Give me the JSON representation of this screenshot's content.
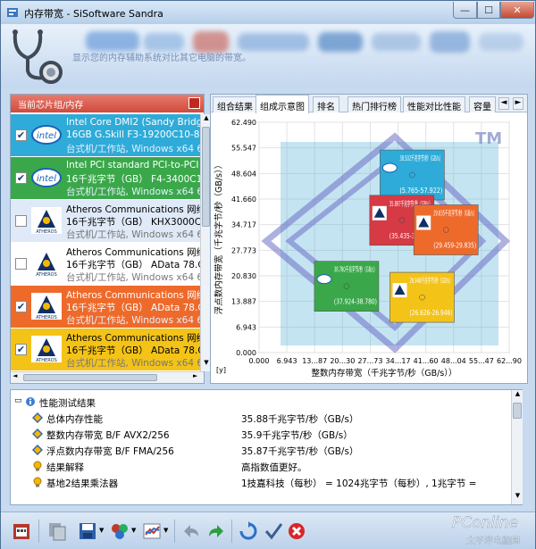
{
  "window": {
    "title": "内存带宽 - SiSoftware Sandra",
    "minimize": "—",
    "maximize": "☐",
    "close": "✕"
  },
  "header": {
    "description": "显示您的内存辅助系统对比其它电脑的带宽。"
  },
  "left_panel": {
    "title": "当前芯片组/内存",
    "items": [
      {
        "checked": true,
        "logo": "intel-logo",
        "line1": "Intel Core DMI2 (Sandy Bridge",
        "line2": "16GB G.Skill F3-19200C10-8GE",
        "line3": "台式机/工作站, Windows x64 6.1",
        "bg": "#2eabd8"
      },
      {
        "checked": true,
        "logo": "intel-logo",
        "line1": "Intel PCI standard PCI-to-PCI b",
        "line2": "16千兆字节（GB） F4-3400C16-",
        "line3": "台式机/工作站, Windows x64 6.1",
        "bg": "#3aa84a"
      },
      {
        "checked": false,
        "logo": "atheros-logo",
        "line1": "Atheros Communications 网络",
        "line2": "16千兆字节（GB） KHX3000C1",
        "line3": "台式机/工作站, Windows x64 6.",
        "bg": "#dfe9f7"
      },
      {
        "checked": false,
        "logo": "atheros-logo",
        "line1": "Atheros Communications 网络",
        "line2": "16千兆字节（GB） AData 78.CA",
        "line3": "台式机/工作站, Windows x64 6.",
        "bg": "#ffffff"
      },
      {
        "checked": true,
        "logo": "atheros-logo",
        "line1": "Atheros Communications 网络",
        "line2": "16千兆字节（GB） AData 78.CA",
        "line3": "台式机/工作站, Windows x64 6.",
        "bg": "#ee6a2b"
      },
      {
        "checked": true,
        "logo": "atheros-logo",
        "line1": "Atheros Communications 网络",
        "line2": "16千兆字节（GB） AData 78.CA",
        "line3": "台式机/工作站, Windows x64 6.",
        "bg": "#f4c318"
      }
    ]
  },
  "tabs": {
    "items": [
      "组合结果",
      "组成示意图",
      "排名",
      "热门排行榜",
      "性能对比性能",
      "容量"
    ],
    "active": 1,
    "prev": "◄",
    "next": "►"
  },
  "chart_data": {
    "type": "scatter",
    "xlabel": "整数内存带宽（千兆字节/秒（GB/s））",
    "ylabel": "浮点数内存带宽（千兆字节/秒（GB/s））",
    "xlim": [
      0,
      62.9
    ],
    "ylim": [
      0,
      62.49
    ],
    "x_ticks": [
      "0.000",
      "6.943",
      "13...87",
      "20...30",
      "27...73",
      "34...17",
      "41...60",
      "48...04",
      "55...47",
      "62...90"
    ],
    "y_ticks": [
      "0.000",
      "6.943",
      "13.887",
      "20.830",
      "27.773",
      "34.717",
      "41.660",
      "48.604",
      "55.547",
      "62.490"
    ],
    "y_unit": "[y]",
    "watermark": "TM",
    "boxes": [
      {
        "value": "38.502千兆字节/秒（GB/s）",
        "range": "(5.765-57.922)",
        "color": "#2eabd8",
        "logo": "intel",
        "x": 38.5,
        "y": 48.2
      },
      {
        "value": "35.897千兆字节/秒（GB/s）",
        "range": "(35.435-35.897)",
        "color": "#d53a45",
        "logo": "atheros",
        "x": 35.9,
        "y": 35.9
      },
      {
        "value": "29.835千兆字节/秒（GB/s）",
        "range": "(29.459-29.835)",
        "color": "#ee6a2b",
        "logo": "atheros",
        "x": 47.0,
        "y": 33.3
      },
      {
        "value": "38.780千兆字节/秒（GB/s）",
        "range": "(37.924-38.780)",
        "color": "#3aa84a",
        "logo": "intel",
        "x": 22.0,
        "y": 18.0
      },
      {
        "value": "26.946千兆字节/秒（GB/s）",
        "range": "(26.626-26.946)",
        "color": "#f4c318",
        "logo": "atheros",
        "x": 41.0,
        "y": 15.0
      }
    ]
  },
  "results": {
    "header": "性能测试结果",
    "rows": [
      {
        "icon": "diamond-icon",
        "name": "总体内存性能",
        "value": "35.88千兆字节/秒（GB/s）"
      },
      {
        "icon": "diamond-icon",
        "name": "整数内存带宽 B/F AVX2/256",
        "value": "35.9千兆字节/秒（GB/s）"
      },
      {
        "icon": "diamond-icon",
        "name": "浮点数内存带宽 B/F FMA/256",
        "value": "35.87千兆字节/秒（GB/s）"
      },
      {
        "icon": "bulb-icon",
        "name": "结果解释",
        "value": "高指数值更好。"
      },
      {
        "icon": "bulb-icon",
        "name": "基地2结果乘法器",
        "value": "1技嘉科技（每秒） = 1024兆字节（每秒）, 1兆字节 ="
      }
    ]
  },
  "watermark": {
    "brand": "PConline",
    "subtitle": "太平洋电脑网"
  }
}
